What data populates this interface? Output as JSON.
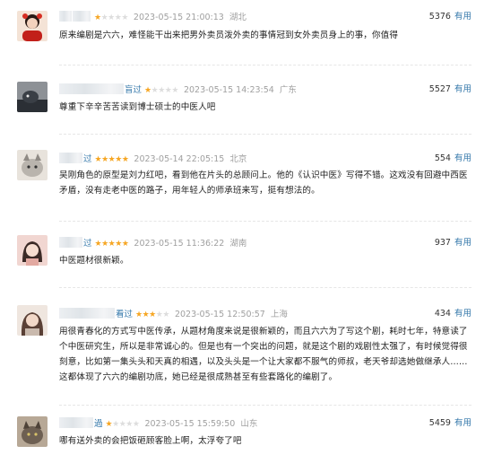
{
  "comments": [
    {
      "name_suffix": "",
      "stars_text": "★☆☆☆☆",
      "time": "2023-05-15 21:00:13",
      "location": "湖北",
      "votes": "5376",
      "useful_label": "有用",
      "content": "原来编剧是六六，难怪能干出来把男外卖员泼外卖的事情冠到女外卖员身上的事，你值得",
      "avatar_colors": [
        "#c2201a",
        "#f4e3d6"
      ]
    },
    {
      "name_suffix": "盲过",
      "stars_text": "★☆☆☆☆",
      "time": "2023-05-15 14:23:54",
      "location": "广东",
      "votes": "5527",
      "useful_label": "有用",
      "content": "尊重下辛辛苦苦读到博士硕士的中医人吧",
      "avatar_colors": [
        "#2b2f35",
        "#8d9196"
      ]
    },
    {
      "name_suffix": "过",
      "stars_text": "★★★★★",
      "time": "2023-05-14 22:05:15",
      "location": "北京",
      "votes": "554",
      "useful_label": "有用",
      "content": "吴刚角色的原型是刘力红吧，看到他在片头的总顾问上。他的《认识中医》写得不错。这戏没有回避中西医矛盾，没有走老中医的路子，用年轻人的师承班来写，挺有想法的。",
      "avatar_colors": [
        "#b9b4ad",
        "#e8e3dc"
      ]
    },
    {
      "name_suffix": "过",
      "stars_text": "★★★★★",
      "time": "2023-05-15 11:36:22",
      "location": "湖南",
      "votes": "937",
      "useful_label": "有用",
      "content": "中医题材很新颖。",
      "avatar_colors": [
        "#f1d6d1",
        "#3b2a26"
      ]
    },
    {
      "name_suffix": "看过",
      "stars_text": "★★★☆☆",
      "time": "2023-05-15 12:50:57",
      "location": "上海",
      "votes": "434",
      "useful_label": "有用",
      "content": "用很青春化的方式写中医传承，从题材角度来说是很新颖的，而且六六为了写这个剧，耗时七年，特意读了个中医研究生，所以是非常诚心的。但是也有一个突出的问题，就是这个剧的戏剧性太强了，有时候觉得很刻意，比如第一集头头和天真的相遇，以及头头是一个让大家都不服气的师叔，老天爷却选她做继承人……这都体现了六六的编剧功底，她已经是很成熟甚至有些套路化的编剧了。",
      "avatar_colors": [
        "#c9b9ad",
        "#efe6df"
      ]
    },
    {
      "name_suffix": "過",
      "stars_text": "★☆☆☆☆",
      "time": "2023-05-15 15:59:50",
      "location": "山东",
      "votes": "5459",
      "useful_label": "有用",
      "content": "哪有送外卖的会把饭砸顾客脸上啊，太浮夸了吧",
      "avatar_colors": [
        "#6d5f52",
        "#b7a896"
      ]
    }
  ]
}
